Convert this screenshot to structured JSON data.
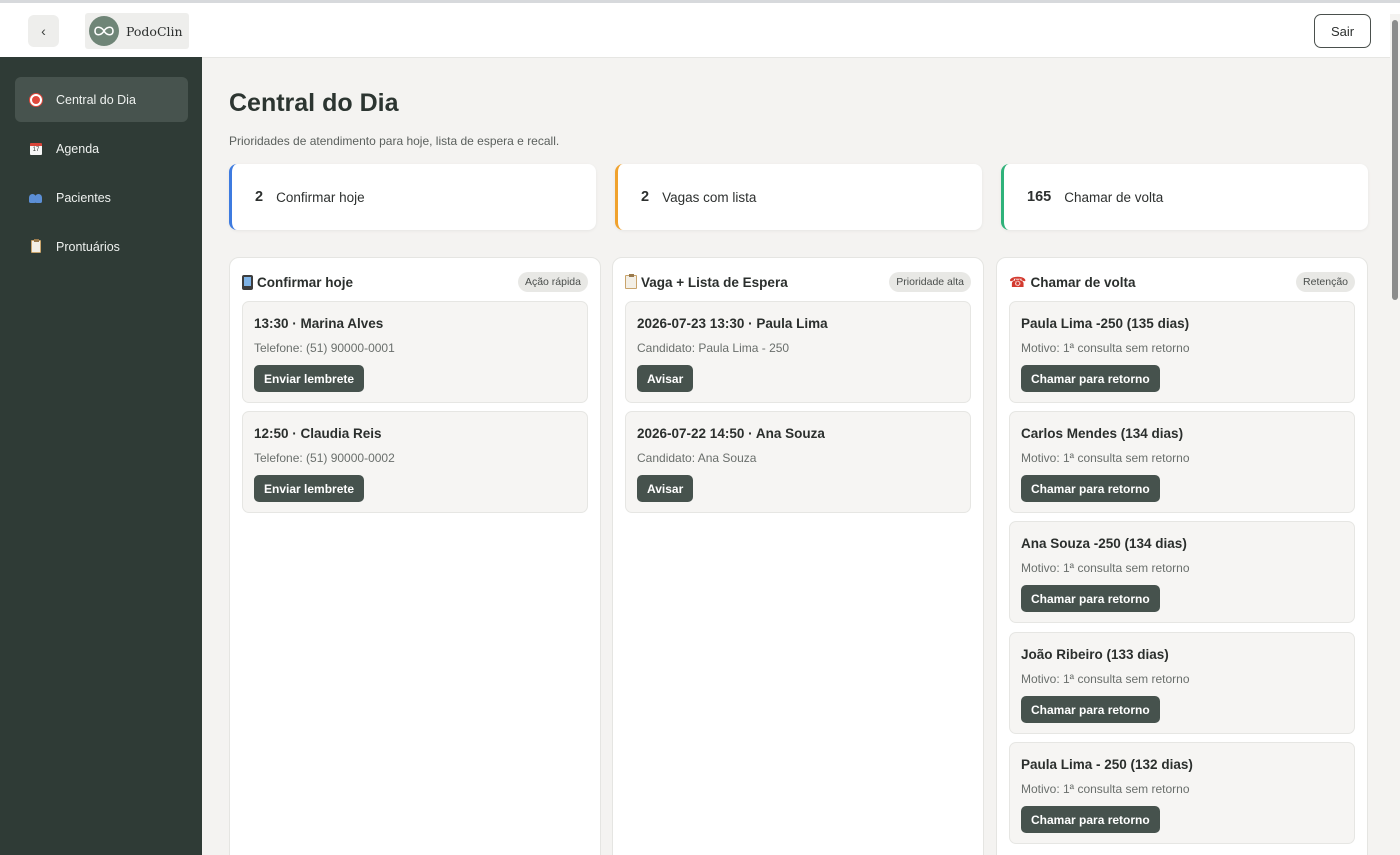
{
  "header": {
    "back_label": "‹",
    "logo_text": "PodoClin",
    "exit_label": "Sair"
  },
  "sidebar": {
    "items": [
      {
        "label": "Central do Dia",
        "icon": "target-icon",
        "active": true
      },
      {
        "label": "Agenda",
        "icon": "calendar-icon",
        "active": false
      },
      {
        "label": "Pacientes",
        "icon": "people-icon",
        "active": false
      },
      {
        "label": "Prontuários",
        "icon": "clipboard-icon",
        "active": false
      }
    ]
  },
  "main": {
    "title": "Central do Dia",
    "subtitle": "Prioridades de atendimento para hoje, lista de espera e recall.",
    "stats": [
      {
        "value": "2",
        "label": "Confirmar hoje",
        "accent": "#3e7be0"
      },
      {
        "value": "2",
        "label": "Vagas com lista",
        "accent": "#f0a22e"
      },
      {
        "value": "165",
        "label": "Chamar de volta",
        "accent": "#2fb27a"
      }
    ],
    "panels": [
      {
        "title": "Confirmar hoje",
        "icon": "mobile-phone-icon",
        "badge": "Ação rápida",
        "items": [
          {
            "title": "13:30 · Marina Alves",
            "sub": "Telefone: (51) 90000-0001",
            "button": "Enviar lembrete"
          },
          {
            "title": "12:50 · Claudia Reis",
            "sub": "Telefone: (51) 90000-0002",
            "button": "Enviar lembrete"
          }
        ]
      },
      {
        "title": "Vaga + Lista de Espera",
        "icon": "clipboard-icon",
        "badge": "Prioridade alta",
        "items": [
          {
            "title": "2026-07-23 13:30 · Paula Lima",
            "sub": "Candidato: Paula Lima - 250",
            "button": "Avisar"
          },
          {
            "title": "2026-07-22 14:50 · Ana Souza",
            "sub": "Candidato: Ana Souza",
            "button": "Avisar"
          }
        ]
      },
      {
        "title": "Chamar de volta",
        "icon": "telephone-icon",
        "badge": "Retenção",
        "items": [
          {
            "title": "Paula Lima -250 (135 dias)",
            "sub": "Motivo: 1ª consulta sem retorno",
            "button": "Chamar para retorno"
          },
          {
            "title": "Carlos Mendes (134 dias)",
            "sub": "Motivo: 1ª consulta sem retorno",
            "button": "Chamar para retorno"
          },
          {
            "title": "Ana Souza -250 (134 dias)",
            "sub": "Motivo: 1ª consulta sem retorno",
            "button": "Chamar para retorno"
          },
          {
            "title": "João Ribeiro (133 dias)",
            "sub": "Motivo: 1ª consulta sem retorno",
            "button": "Chamar para retorno"
          },
          {
            "title": "Paula Lima - 250 (132 dias)",
            "sub": "Motivo: 1ª consulta sem retorno",
            "button": "Chamar para retorno"
          }
        ]
      }
    ]
  }
}
